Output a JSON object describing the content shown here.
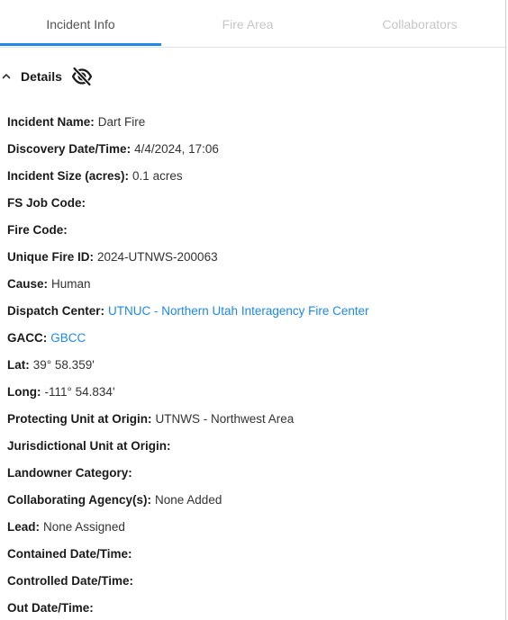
{
  "tabs": [
    {
      "label": "Incident Info",
      "active": true
    },
    {
      "label": "Fire Area",
      "active": false
    },
    {
      "label": "Collaborators",
      "active": false
    }
  ],
  "section": {
    "title": "Details",
    "chevron_icon": "chevron-up-icon",
    "visibility_icon": "eye-off-icon"
  },
  "fields": {
    "incident_name": {
      "label": "Incident Name:",
      "value": "Dart Fire"
    },
    "discovery": {
      "label": "Discovery Date/Time:",
      "value": "4/4/2024, 17:06"
    },
    "size": {
      "label": "Incident Size (acres):",
      "value": "0.1 acres"
    },
    "fs_job_code": {
      "label": "FS Job Code:",
      "value": ""
    },
    "fire_code": {
      "label": "Fire Code:",
      "value": ""
    },
    "unique_fire_id": {
      "label": "Unique Fire ID:",
      "value": "2024-UTNWS-200063"
    },
    "cause": {
      "label": "Cause:",
      "value": "Human"
    },
    "dispatch_center": {
      "label": "Dispatch Center:",
      "value": "UTNUC - Northern Utah Interagency Fire Center"
    },
    "gacc": {
      "label": "GACC:",
      "value": "GBCC"
    },
    "lat": {
      "label": "Lat:",
      "value": "39° 58.359'"
    },
    "long": {
      "label": "Long:",
      "value": "-111° 54.834'"
    },
    "protecting_unit": {
      "label": "Protecting Unit at Origin:",
      "value": "UTNWS - Northwest Area"
    },
    "jurisdictional_unit": {
      "label": "Jurisdictional Unit at Origin:",
      "value": ""
    },
    "landowner_category": {
      "label": "Landowner Category:",
      "value": ""
    },
    "collaborating_agencies": {
      "label": "Collaborating Agency(s):",
      "value": "None Added"
    },
    "lead": {
      "label": "Lead:",
      "value": "None Assigned"
    },
    "contained": {
      "label": "Contained Date/Time:",
      "value": ""
    },
    "controlled": {
      "label": "Controlled Date/Time:",
      "value": ""
    },
    "out": {
      "label": "Out Date/Time:",
      "value": ""
    }
  },
  "colors": {
    "accent": "#1e88e5",
    "active_tab_text": "#555555",
    "inactive_tab_text": "#c7c7c7"
  }
}
